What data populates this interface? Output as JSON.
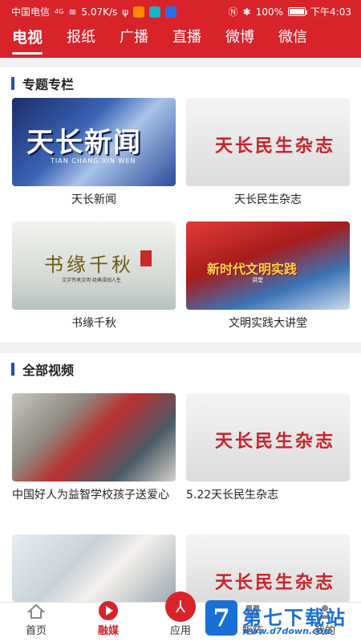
{
  "status_bar": {
    "carrier": "中国电信",
    "network": "4G",
    "speed": "5.07K/s",
    "battery": "100%",
    "time": "下午4:03"
  },
  "tabs": [
    {
      "label": "电视",
      "active": true
    },
    {
      "label": "报纸"
    },
    {
      "label": "广播"
    },
    {
      "label": "直播"
    },
    {
      "label": "微博"
    },
    {
      "label": "微信"
    }
  ],
  "featured": {
    "title": "专题专栏",
    "items": [
      {
        "caption": "天长新闻",
        "thumb_text": "天长新闻",
        "thumb_sub": "TIAN CHANG XIN WEN"
      },
      {
        "caption": "天长民生杂志",
        "thumb_text": "天长民生杂志"
      },
      {
        "caption": "书缘千秋",
        "thumb_text": "书缘千秋",
        "thumb_sub": "文字传承文明 经典浸润人生"
      },
      {
        "caption": "文明实践大讲堂",
        "thumb_text": "新时代文明实践",
        "thumb_sub": "讲堂"
      }
    ]
  },
  "all_videos": {
    "title": "全部视频",
    "items": [
      {
        "caption": "中国好人为益智学校孩子送爱心"
      },
      {
        "caption": "5.22天长民生杂志",
        "thumb_text": "天长民生杂志"
      },
      {
        "caption": ""
      },
      {
        "caption": "",
        "thumb_text": "天长民生杂志"
      }
    ]
  },
  "bottom_nav": [
    {
      "label": "首页",
      "icon": "home-icon"
    },
    {
      "label": "融媒",
      "icon": "play-icon",
      "active": true
    },
    {
      "label": "应用",
      "icon": "apps-icon"
    },
    {
      "label": "矩阵",
      "icon": "grid-icon"
    },
    {
      "label": "我的",
      "icon": "user-icon"
    }
  ],
  "watermark": {
    "logo": "7",
    "name": "第七下载站",
    "url": "www.d7down.com"
  },
  "colors": {
    "brand_red": "#d8232a",
    "section_bar": "#1f4fbf"
  }
}
